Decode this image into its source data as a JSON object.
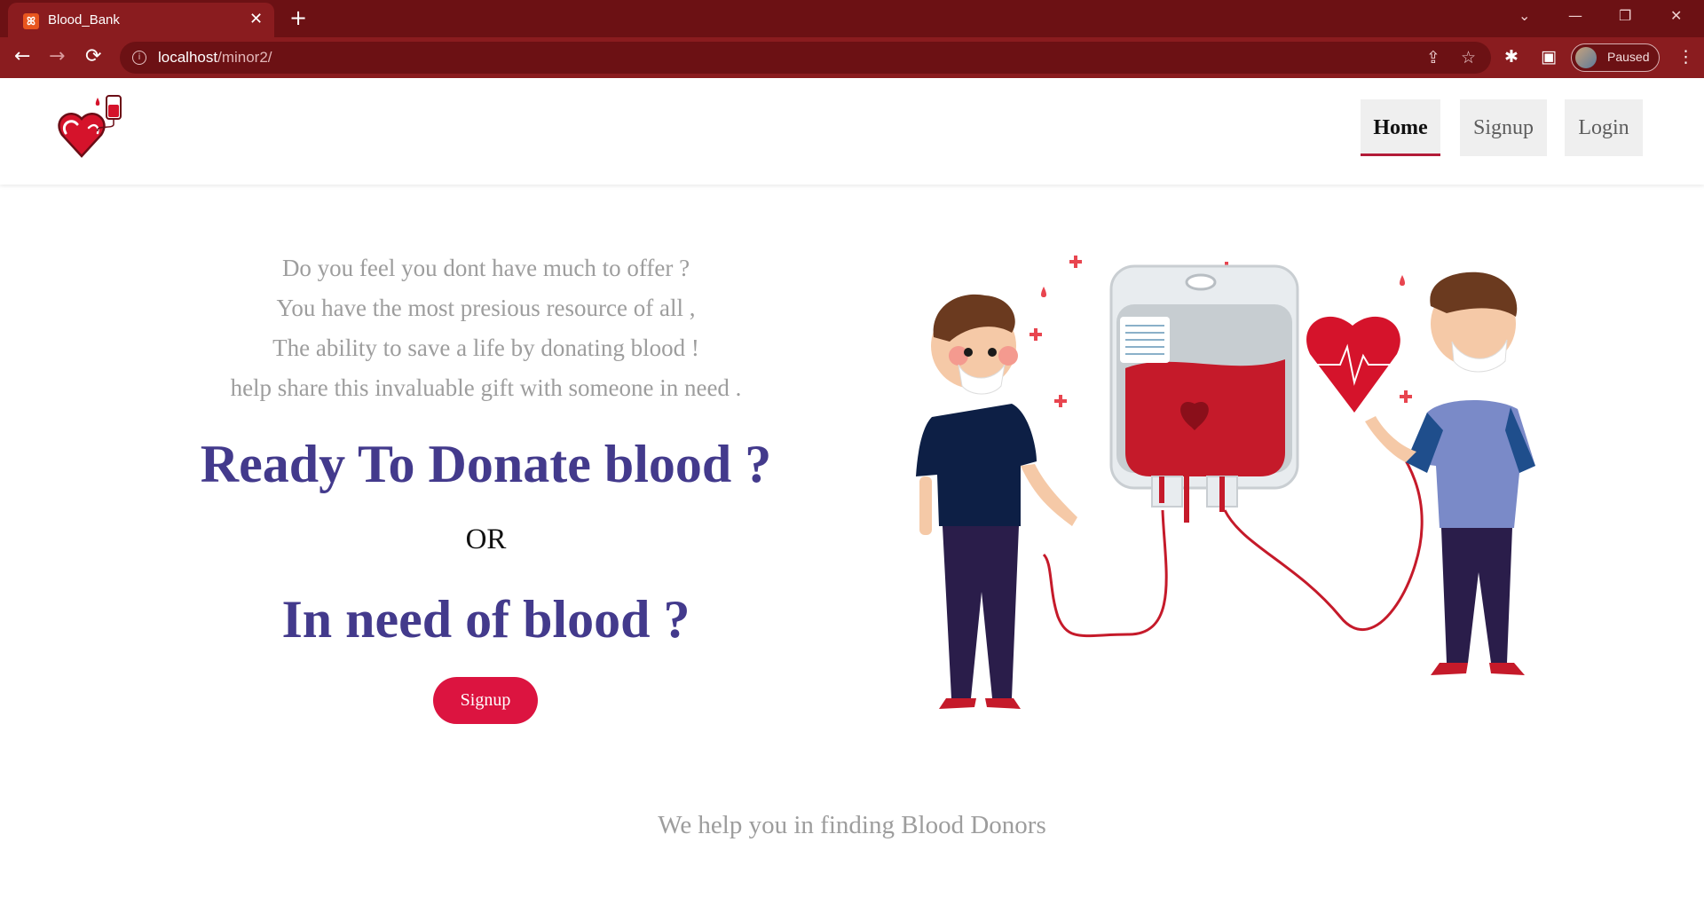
{
  "browser": {
    "tab_title": "Blood_Bank",
    "tab_close": "✕",
    "new_tab": "+",
    "url_host": "localhost",
    "url_path": "/minor2/",
    "profile_label": "Paused",
    "window_controls": {
      "dropdown": "⌄",
      "minimize": "—",
      "restore": "❐",
      "close": "✕"
    },
    "nav": {
      "back": "←",
      "forward": "→",
      "reload": "⟳"
    },
    "icons": {
      "favicon": "xampp-icon",
      "share": "share-icon",
      "bookmark": "star-icon",
      "extensions": "puzzle-icon",
      "side_panel": "side-panel-icon",
      "menu": "kebab-menu-icon"
    },
    "theme_color": "#8a1c1f"
  },
  "header": {
    "logo": "blood-bag-heart-logo",
    "nav": [
      {
        "label": "Home",
        "active": true
      },
      {
        "label": "Signup",
        "active": false
      },
      {
        "label": "Login",
        "active": false
      }
    ],
    "active_underline_color": "#b31b38"
  },
  "hero": {
    "intro_lines": [
      "Do you feel you dont have much to offer ?",
      "You have the most presious resource of all ,",
      "The ability to save a life by donating blood !",
      "help share this invaluable gift with someone in need ."
    ],
    "headline_1": "Ready To Donate blood ?",
    "or_text": "OR",
    "headline_2": "In need of blood ?",
    "cta_label": "Signup",
    "headline_color": "#433a8c",
    "cta_color": "#dc1440",
    "illustration": "blood-donation-illustration"
  },
  "footer": {
    "tagline": "We help you in finding Blood Donors"
  }
}
